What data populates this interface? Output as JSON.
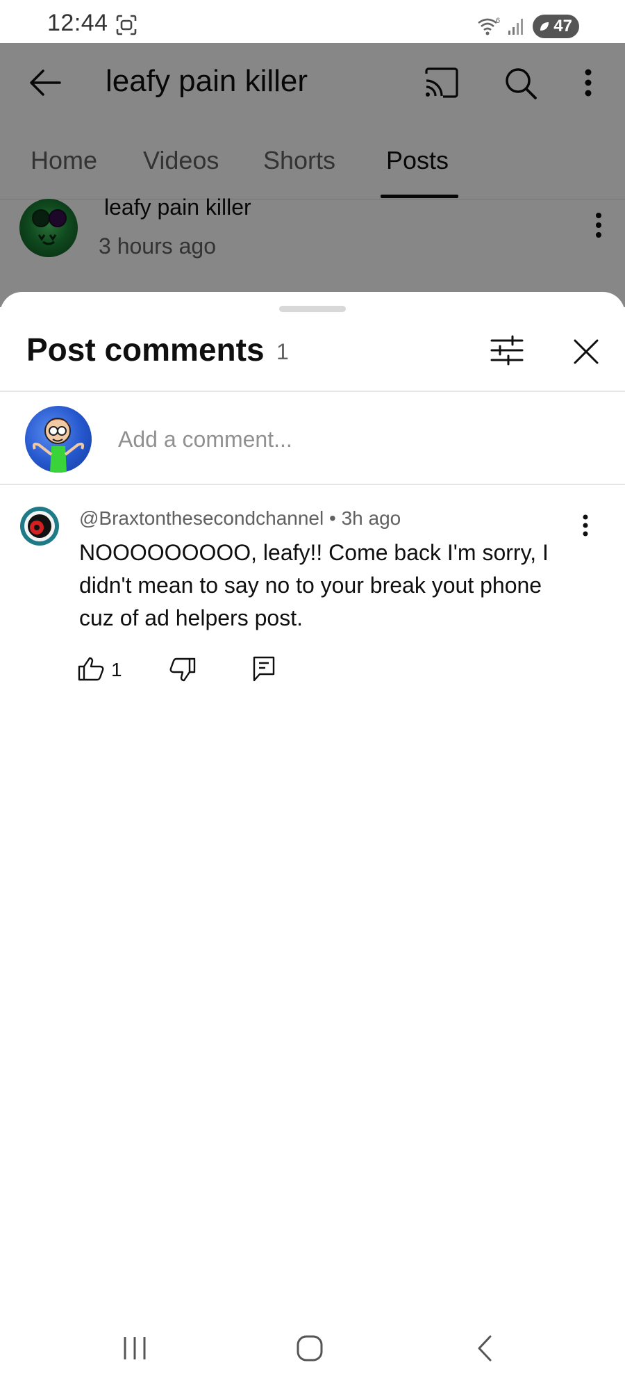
{
  "status_bar": {
    "time": "12:44",
    "battery": "47",
    "icons": [
      "screenshot-icon",
      "wifi-icon",
      "signal-icon",
      "battery-icon"
    ]
  },
  "app_bar": {
    "channel_title": "leafy pain killer",
    "icons": [
      "back-arrow-icon",
      "cast-icon",
      "search-icon",
      "more-vert-icon"
    ]
  },
  "tabs": [
    {
      "label": "Home",
      "active": false
    },
    {
      "label": "Videos",
      "active": false
    },
    {
      "label": "Shorts",
      "active": false
    },
    {
      "label": "Posts",
      "active": true
    }
  ],
  "post": {
    "author": "leafy pain killer",
    "time": "3 hours ago"
  },
  "comments_sheet": {
    "title": "Post comments",
    "count": "1",
    "add_comment_placeholder": "Add a comment...",
    "icons": [
      "filter-icon",
      "close-icon"
    ]
  },
  "comments": [
    {
      "author": "@Braxtonthesecondchannel",
      "separator": " • ",
      "time": "3h ago",
      "text": "NOOOOOOOOO, leafy!! Come back I'm sorry, I didn't mean to say no to your break yout phone cuz of ad helpers post.",
      "likes": "1",
      "icons": [
        "like-icon",
        "dislike-icon",
        "reply-icon",
        "more-vert-icon"
      ]
    }
  ],
  "colors": {
    "overlay": "#000000",
    "text_primary": "#0f0f0f",
    "text_secondary": "#606060",
    "placeholder": "#909090"
  }
}
